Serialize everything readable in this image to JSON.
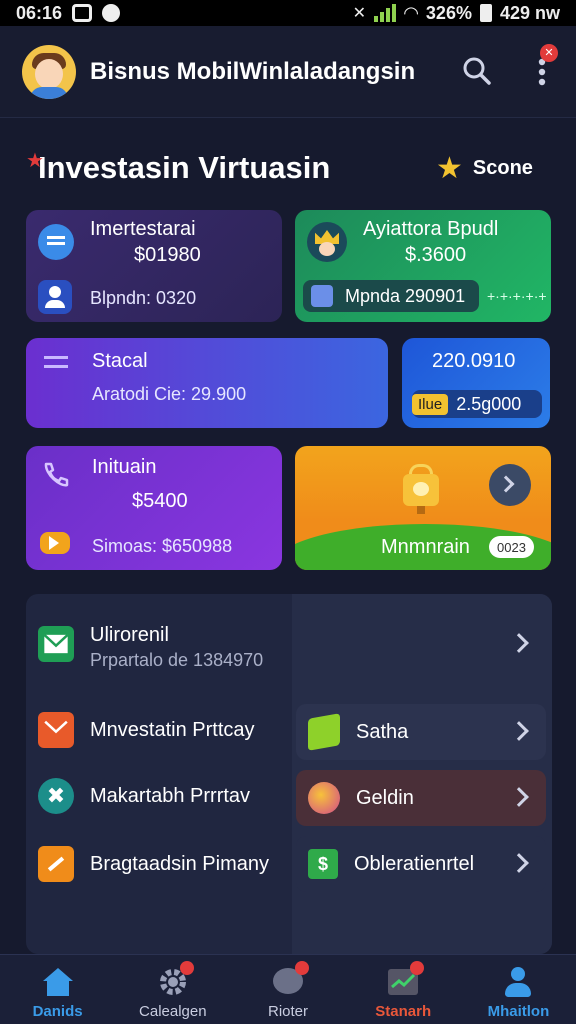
{
  "status_bar": {
    "time": "06:16",
    "battery_text": "326%",
    "clock_right": "429 nw"
  },
  "header": {
    "title": "Bisnus MobilWinlaladangsin"
  },
  "section": {
    "title": "Investasin Virtuasin",
    "store_label": "Scone"
  },
  "cards": {
    "card1": {
      "label": "Imertestarai",
      "amount": "$01980",
      "sub": "Blpndn: 0320"
    },
    "card2": {
      "label": "Ayiattora Bpudl",
      "amount": "$.3600",
      "sub": "Mpnda 290901"
    },
    "card3": {
      "label": "Stacal",
      "sub": "Aratodi Cie: 29.900"
    },
    "card4": {
      "amount": "220.0910",
      "pill_tag": "Ilue",
      "pill_value": "2.5g000"
    },
    "card5": {
      "label": "Inituain",
      "amount": "$5400",
      "sub": "Simoas: $650988"
    },
    "card6": {
      "label": "Mnmnrain",
      "pill": "0023"
    }
  },
  "list": {
    "row1": {
      "title": "Ulirorenil",
      "sub": "Prpartalo de 1384970"
    },
    "row2": {
      "title": "Mnvestatin Prttcay"
    },
    "row3": {
      "title": "Makartabh Prrrtav"
    },
    "row4": {
      "title": "Bragtaadsin Pimany"
    },
    "opt1": {
      "title": "Satha"
    },
    "opt2": {
      "title": "Geldin"
    },
    "opt3": {
      "title": "Obleratienrtel"
    }
  },
  "bottom_nav": {
    "items": [
      {
        "label": "Danids"
      },
      {
        "label": "Calealgen"
      },
      {
        "label": "Rioter"
      },
      {
        "label": "Stanarh"
      },
      {
        "label": "Mhaitlon"
      }
    ]
  },
  "colors": {
    "background": "#161a2e",
    "accent_blue": "#3a9be8",
    "badge_red": "#e23b3b",
    "green_card": "#21b665",
    "purple_card": "#6a2fc8",
    "orange_card": "#f2a41c"
  },
  "icons": [
    "shield-icon",
    "search-icon",
    "more-vertical-icon",
    "star-icon",
    "home-icon",
    "gear-icon",
    "chat-icon",
    "chart-icon",
    "user-icon"
  ]
}
